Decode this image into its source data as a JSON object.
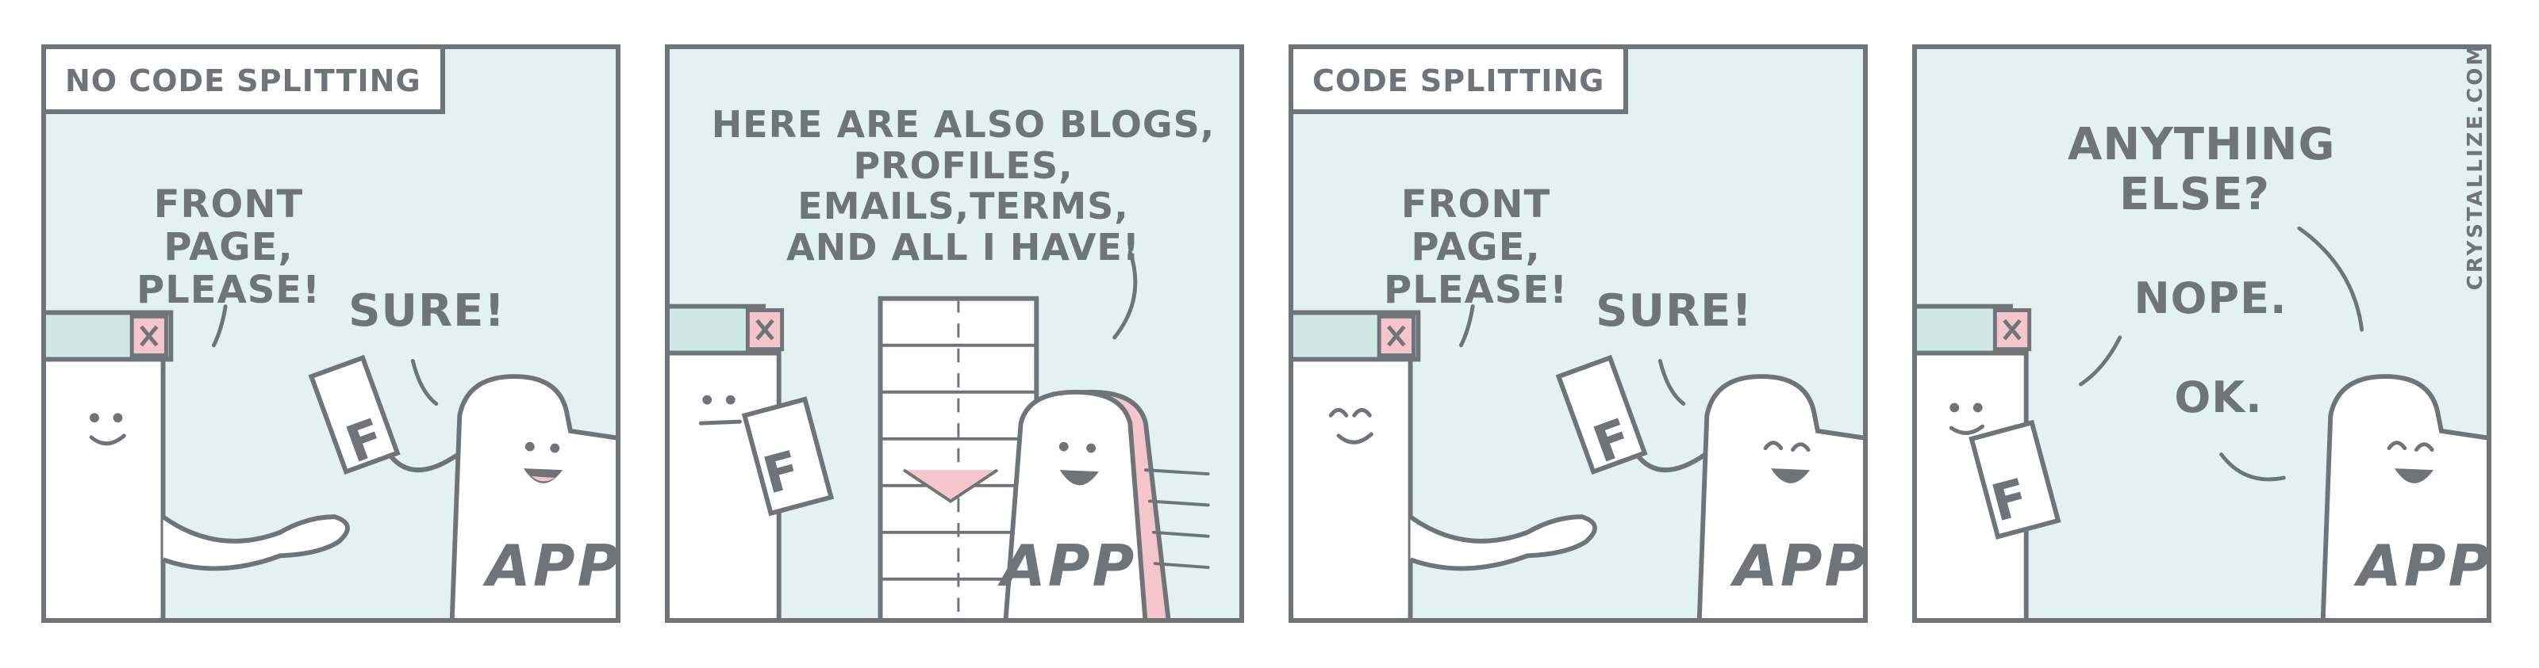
{
  "panels": [
    {
      "label": "NO CODE SPLITTING",
      "browser_says": "FRONT PAGE,\nPLEASE!",
      "app_says": "SURE!",
      "file_letter": "F",
      "app_label": "APP"
    },
    {
      "app_says": "HERE ARE ALSO BLOGS,\nPROFILES, EMAILS,TERMS,\nAND ALL I HAVE!",
      "file_letter": "F",
      "app_label": "APP"
    },
    {
      "label": "CODE SPLITTING",
      "browser_says": "FRONT PAGE,\nPLEASE!",
      "app_says": "SURE!",
      "file_letter": "F",
      "app_label": "APP"
    },
    {
      "app_says": "ANYTHING\nELSE?",
      "browser_says": "NOPE.",
      "app_reply": "OK.",
      "file_letter": "F",
      "app_label": "APP"
    }
  ],
  "credit": "CRYSTALLIZE.COM",
  "colors": {
    "panel_bg": "#e3f2f0",
    "outline": "#6f7478",
    "close_button": "#f4c6cc",
    "title_bar": "#cfe8e4"
  }
}
